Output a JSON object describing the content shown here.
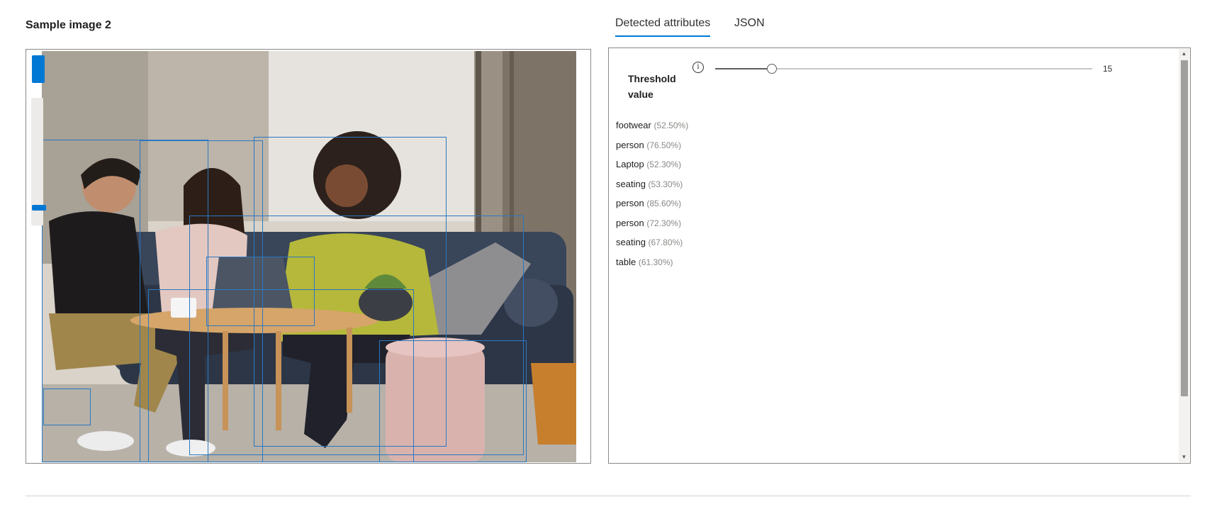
{
  "sample": {
    "title": "Sample image 2"
  },
  "tabs": [
    {
      "label": "Detected attributes",
      "active": true
    },
    {
      "label": "JSON",
      "active": false
    }
  ],
  "threshold": {
    "label": "Threshold value",
    "value": "15",
    "fraction": 0.15,
    "info_icon": "info-icon"
  },
  "attributes": [
    {
      "name": "footwear",
      "confidence": "(52.50%)"
    },
    {
      "name": "person",
      "confidence": "(76.50%)"
    },
    {
      "name": "Laptop",
      "confidence": "(52.30%)"
    },
    {
      "name": "seating",
      "confidence": "(53.30%)"
    },
    {
      "name": "person",
      "confidence": "(85.60%)"
    },
    {
      "name": "person",
      "confidence": "(72.30%)"
    },
    {
      "name": "seating",
      "confidence": "(67.80%)"
    },
    {
      "name": "table",
      "confidence": "(61.30%)"
    }
  ],
  "colors": {
    "accent": "#0078d4",
    "bbox": "#2b78c2"
  }
}
